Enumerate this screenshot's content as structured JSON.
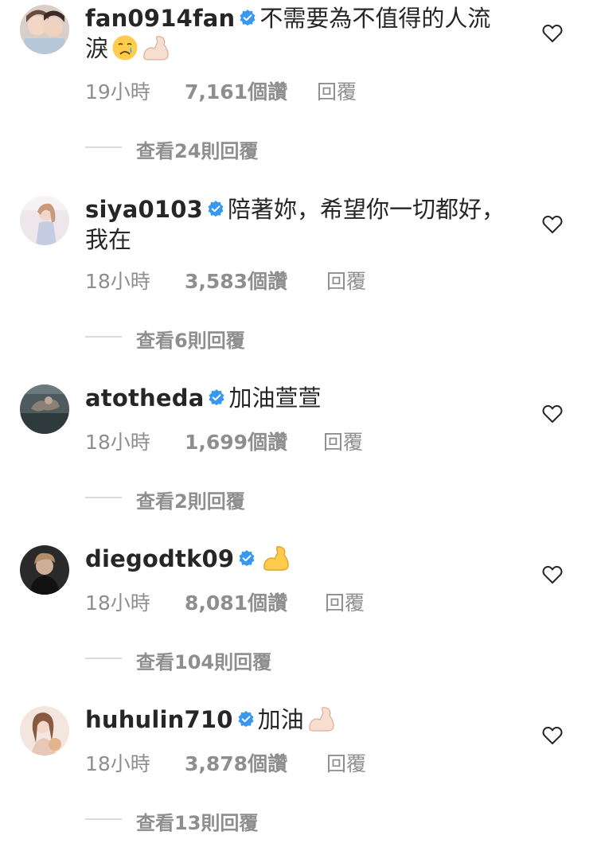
{
  "comments": [
    {
      "username": "fan0914fan",
      "text": "不需要為不值得的人流淚",
      "emojis": [
        "crying-face",
        "flexed-biceps-light"
      ],
      "time": "19小時",
      "likes": "7,161個讚",
      "reply_label": "回覆",
      "view_replies": "查看24則回覆"
    },
    {
      "username": "siya0103",
      "text": "陪著妳，希望你一切都好，我在",
      "emojis": [],
      "time": "18小時",
      "likes": "3,583個讚",
      "reply_label": "回覆",
      "view_replies": "查看6則回覆"
    },
    {
      "username": "atotheda",
      "text": "加油萱萱",
      "emojis": [],
      "time": "18小時",
      "likes": "1,699個讚",
      "reply_label": "回覆",
      "view_replies": "查看2則回覆"
    },
    {
      "username": "diegodtk09",
      "text": "",
      "emojis": [
        "flexed-biceps-yellow"
      ],
      "time": "18小時",
      "likes": "8,081個讚",
      "reply_label": "回覆",
      "view_replies": "查看104則回覆"
    },
    {
      "username": "huhulin710",
      "text": "加油",
      "emojis": [
        "flexed-biceps-light"
      ],
      "time": "18小時",
      "likes": "3,878個讚",
      "reply_label": "回覆",
      "view_replies": "查看13則回覆"
    }
  ],
  "icons": {
    "verified": "verified-badge-icon",
    "like": "heart-outline-icon"
  },
  "colors": {
    "verified_blue": "#3897f0",
    "meta_gray": "#8e8e8e",
    "text": "#262626",
    "divider": "#dbdbdb"
  }
}
